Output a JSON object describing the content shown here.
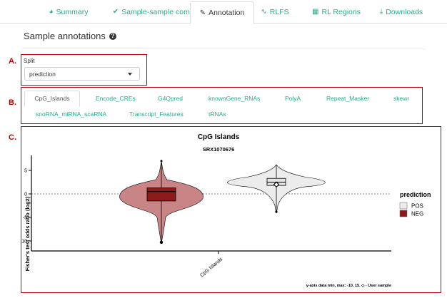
{
  "top_tabs": [
    {
      "label": "Summary",
      "icon": "pie-chart-icon",
      "active": false
    },
    {
      "label": "Sample-sample comparison",
      "icon": "double-check-icon",
      "active": false
    },
    {
      "label": "Annotation",
      "icon": "paint-brush-icon",
      "active": true
    },
    {
      "label": "RLFS",
      "icon": "wave-icon",
      "active": false
    },
    {
      "label": "RL Regions",
      "icon": "map-icon",
      "active": false
    },
    {
      "label": "Downloads",
      "icon": "download-icon",
      "active": false
    }
  ],
  "page_title": "Sample annotations",
  "section_letters": {
    "a": "A.",
    "b": "B.",
    "c": "C."
  },
  "split": {
    "label": "Split",
    "value": "prediction"
  },
  "annotation_tabs": [
    {
      "label": "CpG_Islands",
      "active": true
    },
    {
      "label": "Encode_CREs",
      "active": false
    },
    {
      "label": "G4Qpred",
      "active": false
    },
    {
      "label": "knownGene_RNAs",
      "active": false
    },
    {
      "label": "PolyA",
      "active": false
    },
    {
      "label": "Repeat_Masker",
      "active": false
    },
    {
      "label": "skewr",
      "active": false
    },
    {
      "label": "snoRNA_miRNA_scaRNA",
      "active": false
    },
    {
      "label": "Transcript_Features",
      "active": false
    },
    {
      "label": "tRNAs",
      "active": false
    }
  ],
  "colors": {
    "accent": "#2aa98a",
    "highlight": "#c00000",
    "neg": "#8b1a1a",
    "neg_violin": "#c98585",
    "pos_violin": "#ececec"
  },
  "chart_data": {
    "type": "violin",
    "title": "CpG Islands",
    "subtitle": "SRX1070676",
    "xlabel": "",
    "ylabel": "Fisher's test odds ratio (log2)",
    "categories": [
      "CpG Islands"
    ],
    "yticks": [
      5,
      0,
      -5,
      -10
    ],
    "ylim": [
      -11,
      8
    ],
    "legend": {
      "title": "prediction",
      "position": "right",
      "entries": [
        {
          "name": "POS",
          "color": "#ececec"
        },
        {
          "name": "NEG",
          "color": "#8b1a1a"
        }
      ]
    },
    "series": [
      {
        "name": "NEG",
        "median": 0.5,
        "q1": -1.5,
        "q3": 1.3,
        "min": -10.3,
        "max": 7,
        "whisker_low": -10.3,
        "whisker_high": 7
      },
      {
        "name": "POS",
        "median": 2.5,
        "q1": 1.8,
        "q3": 3.3,
        "min": -4,
        "max": 6.2,
        "user_sample": 2
      }
    ],
    "reference_line": 0,
    "footnote": "y-axis data min, max: -10, 15. ◇ - User sample"
  }
}
